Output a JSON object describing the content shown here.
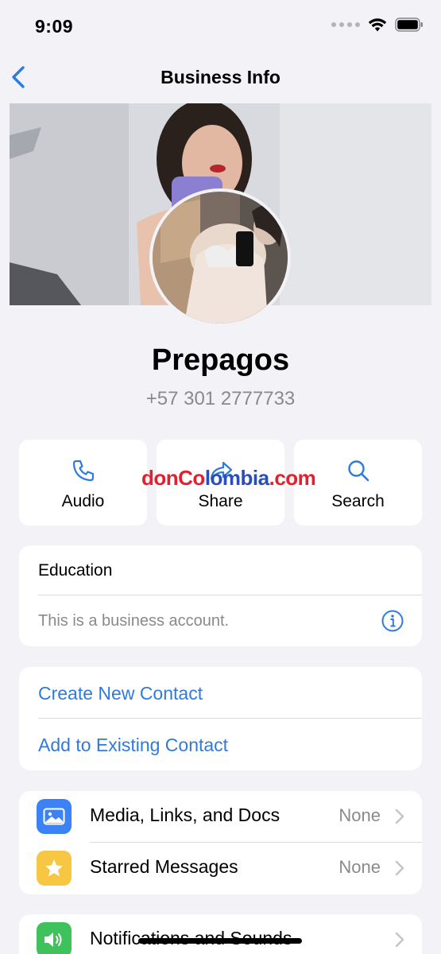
{
  "status_bar": {
    "time": "9:09"
  },
  "nav": {
    "title": "Business Info"
  },
  "profile": {
    "name": "Prepagos",
    "phone": "+57 301 2777733"
  },
  "actions": [
    {
      "label": "Audio",
      "icon": "phone-icon"
    },
    {
      "label": "Share",
      "icon": "share-icon"
    },
    {
      "label": "Search",
      "icon": "search-icon"
    }
  ],
  "watermark": {
    "part1": "donCo",
    "part2": "lombia",
    "part3": ".com"
  },
  "business": {
    "label": "Education",
    "description": "This is a business account."
  },
  "contact": {
    "create": "Create New Contact",
    "add_existing": "Add to Existing Contact"
  },
  "media_rows": [
    {
      "label": "Media, Links, and Docs",
      "value": "None",
      "icon": "photo-icon"
    },
    {
      "label": "Starred Messages",
      "value": "None",
      "icon": "star-icon"
    }
  ],
  "notifications": {
    "label": "Notifications and Sounds",
    "icon": "speaker-icon"
  },
  "colors": {
    "accent": "#2f7bdc",
    "background": "#f2f2f7",
    "media_icon": "#3b82f6",
    "star_icon": "#f7c744",
    "speaker_icon": "#3fc25b"
  }
}
